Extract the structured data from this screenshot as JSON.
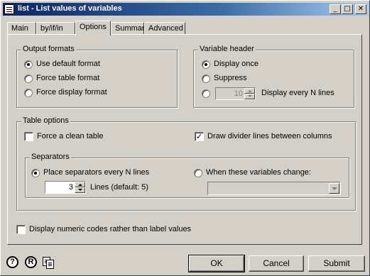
{
  "window": {
    "title": "list - List values of variables",
    "minimize_glyph": "_",
    "maximize_glyph": "□",
    "close_glyph": "✕"
  },
  "tabs": [
    {
      "label": "Main",
      "active": false
    },
    {
      "label": "by/if/in",
      "active": false
    },
    {
      "label": "Options",
      "active": true
    },
    {
      "label": "Summary",
      "active": false
    },
    {
      "label": "Advanced",
      "active": false
    }
  ],
  "output_formats": {
    "title": "Output formats",
    "options": [
      {
        "label": "Use default format",
        "selected": true
      },
      {
        "label": "Force table format",
        "selected": false
      },
      {
        "label": "Force display format",
        "selected": false
      }
    ]
  },
  "variable_header": {
    "title": "Variable header",
    "display_once": {
      "label": "Display once",
      "selected": true
    },
    "suppress": {
      "label": "Suppress",
      "selected": false
    },
    "every_n": {
      "value": "10",
      "label": "Display every N lines",
      "selected": false,
      "enabled": false
    }
  },
  "table_options": {
    "title": "Table options",
    "force_clean": {
      "label": "Force a clean table",
      "checked": false
    },
    "divider_lines": {
      "label": "Draw divider lines between columns",
      "checked": true,
      "check_glyph": "✓"
    },
    "separators": {
      "title": "Separators",
      "every_n": {
        "label": "Place separators every N lines",
        "selected": true,
        "value": "3",
        "hint": "Lines (default: 5)"
      },
      "when_change": {
        "label": "When these variables change:",
        "selected": false,
        "value": ""
      }
    }
  },
  "numeric_codes": {
    "label": "Display numeric codes rather than label values",
    "checked": false
  },
  "footer": {
    "help_glyph": "?",
    "reset_glyph": "R",
    "ok": "OK",
    "cancel": "Cancel",
    "submit": "Submit"
  }
}
